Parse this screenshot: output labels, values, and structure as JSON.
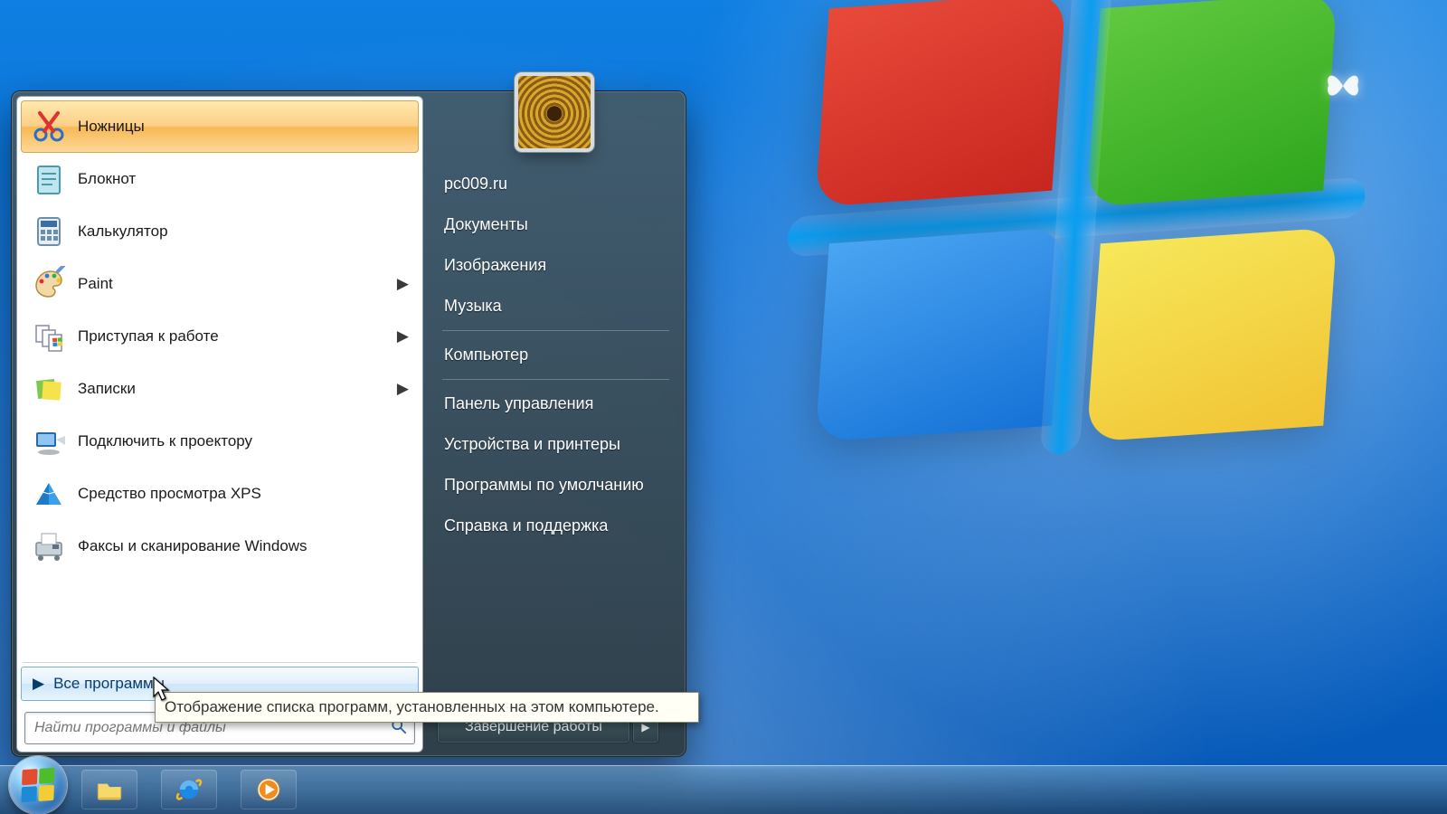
{
  "start_menu": {
    "programs": [
      {
        "label": "Ножницы",
        "has_submenu": false,
        "highlighted": true
      },
      {
        "label": "Блокнот",
        "has_submenu": false,
        "highlighted": false
      },
      {
        "label": "Калькулятор",
        "has_submenu": false,
        "highlighted": false
      },
      {
        "label": "Paint",
        "has_submenu": true,
        "highlighted": false
      },
      {
        "label": "Приступая к работе",
        "has_submenu": true,
        "highlighted": false
      },
      {
        "label": "Записки",
        "has_submenu": true,
        "highlighted": false
      },
      {
        "label": "Подключить к проектору",
        "has_submenu": false,
        "highlighted": false
      },
      {
        "label": "Средство просмотра XPS",
        "has_submenu": false,
        "highlighted": false
      },
      {
        "label": "Факсы и сканирование Windows",
        "has_submenu": false,
        "highlighted": false
      }
    ],
    "all_programs_label": "Все программы",
    "search_placeholder": "Найти программы и файлы",
    "right_panel": {
      "user_label": "pc009.ru",
      "items_group1": [
        "Документы",
        "Изображения",
        "Музыка"
      ],
      "items_group2": [
        "Компьютер"
      ],
      "items_group3": [
        "Панель управления",
        "Устройства и принтеры",
        "Программы по умолчанию",
        "Справка и поддержка"
      ]
    },
    "shutdown_label": "Завершение работы"
  },
  "tooltip_text": "Отображение списка программ, установленных на этом компьютере.",
  "taskbar": {
    "pinned": [
      "file-explorer",
      "internet-explorer",
      "media-player"
    ]
  }
}
